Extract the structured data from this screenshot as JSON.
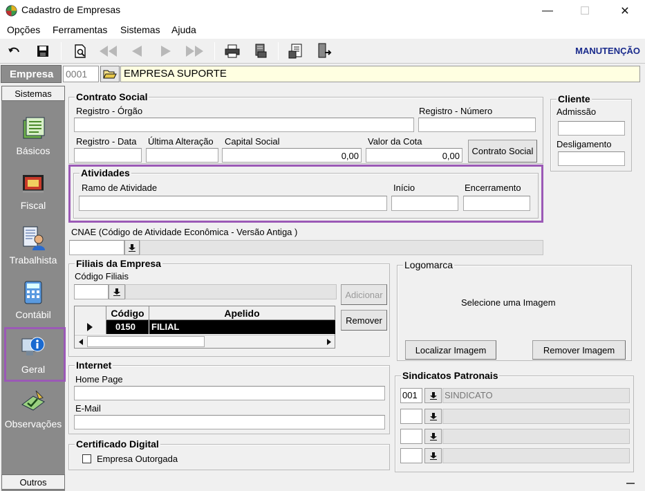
{
  "window": {
    "title": "Cadastro de Empresas",
    "minimize": "—",
    "maximize": "☐",
    "close": "✕"
  },
  "menu": [
    "Opções",
    "Ferramentas",
    "Sistemas",
    "Ajuda"
  ],
  "toolbar": {
    "buttons": [
      "undo-icon",
      "save-icon",
      "preview-icon",
      "first-icon",
      "prev-icon",
      "next-icon",
      "last-icon",
      "print-icon",
      "print-setup-icon",
      "report-icon",
      "exit-icon"
    ],
    "mode": "MANUTENÇÃO"
  },
  "empresa": {
    "label": "Empresa",
    "code": "0001",
    "name": "EMPRESA SUPORTE"
  },
  "sidebar": {
    "header_top": "Sistemas",
    "header_bottom": "Outros",
    "items": [
      {
        "label": "Básicos",
        "icon": "basicos-icon"
      },
      {
        "label": "Fiscal",
        "icon": "fiscal-icon"
      },
      {
        "label": "Trabalhista",
        "icon": "trabalhista-icon"
      },
      {
        "label": "Contábil",
        "icon": "calculator-icon"
      },
      {
        "label": "Geral",
        "icon": "info-monitor-icon"
      },
      {
        "label": "Observações",
        "icon": "pencil-check-icon"
      }
    ]
  },
  "contrato": {
    "title": "Contrato Social",
    "registro_orgao": "Registro - Órgão",
    "registro_numero": "Registro - Número",
    "registro_data": "Registro - Data",
    "ultima_alteracao": "Última Alteração",
    "capital_social": "Capital Social",
    "capital_social_value": "0,00",
    "valor_cota": "Valor da Cota",
    "valor_cota_value": "0,00",
    "button": "Contrato Social"
  },
  "cliente": {
    "title": "Cliente",
    "admissao": "Admissão",
    "desligamento": "Desligamento"
  },
  "atividades": {
    "title": "Atividades",
    "ramo": "Ramo de Atividade",
    "inicio": "Início",
    "encerramento": "Encerramento"
  },
  "cnae": {
    "label": "CNAE (Código de Atividade Econômica - Versão Antiga )"
  },
  "filiais": {
    "title": "Filiais da Empresa",
    "codigo_label": "Código Filiais",
    "add_button": "Adicionar",
    "remove_button": "Remover",
    "columns": [
      "Código",
      "Apelido"
    ],
    "rows": [
      {
        "codigo": "0150",
        "apelido": "FILIAL"
      }
    ]
  },
  "logomarca": {
    "title": "Logomarca",
    "placeholder": "Selecione  uma  Imagem",
    "locate_button": "Localizar Imagem",
    "remove_button": "Remover Imagem"
  },
  "internet": {
    "title": "Internet",
    "home_page": "Home Page",
    "email": "E-Mail"
  },
  "certificado": {
    "title": "Certificado Digital",
    "checkbox_label": "Empresa Outorgada"
  },
  "sindicatos": {
    "title": "Sindicatos Patronais",
    "rows": [
      {
        "code": "001",
        "name": "SINDICATO"
      },
      {
        "code": "",
        "name": ""
      },
      {
        "code": "",
        "name": ""
      },
      {
        "code": "",
        "name": ""
      }
    ]
  }
}
